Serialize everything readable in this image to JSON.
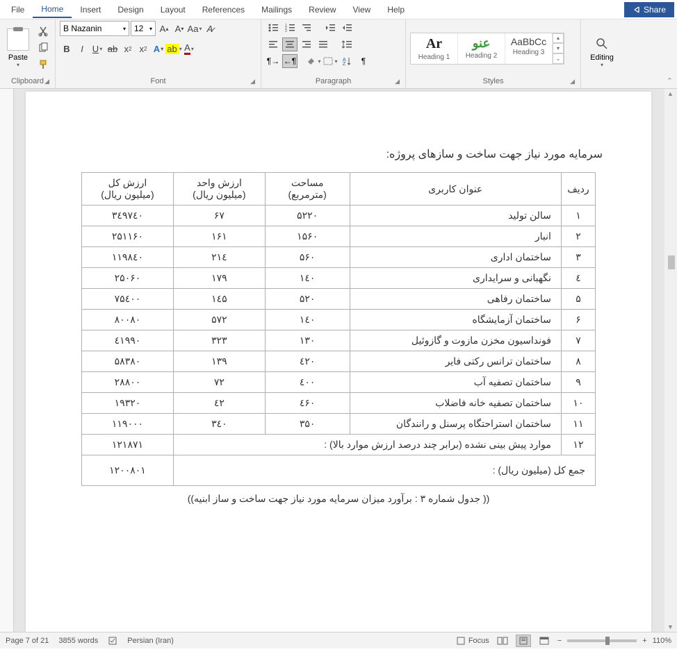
{
  "menu": {
    "items": [
      "File",
      "Home",
      "Insert",
      "Design",
      "Layout",
      "References",
      "Mailings",
      "Review",
      "View",
      "Help"
    ],
    "active": "Home",
    "share": "Share"
  },
  "ribbon": {
    "clipboard": {
      "paste": "Paste",
      "label": "Clipboard"
    },
    "font": {
      "name": "B Nazanin",
      "size": "12",
      "label": "Font"
    },
    "paragraph": {
      "label": "Paragraph"
    },
    "styles": {
      "items": [
        {
          "preview": "Ar",
          "label": "Heading 1",
          "color": "#222",
          "font": "serif",
          "weight": "bold"
        },
        {
          "preview": "ﻋﻨﻮ",
          "label": "Heading 2",
          "color": "#3a9c3a",
          "font": "sans-serif",
          "weight": "bold"
        },
        {
          "preview": "AaBbCc",
          "label": "Heading 3",
          "color": "#444",
          "font": "sans-serif",
          "weight": "normal"
        }
      ],
      "label": "Styles"
    },
    "editing": {
      "label": "Editing"
    }
  },
  "document": {
    "heading": "سرمایه مورد نیاز جهت ساخت و سازهای پروژه:",
    "caption": "(( جدول شماره ۳ : برآورد میزان سرمایه مورد نیاز جهت ساخت و ساز ابنیه))",
    "headers": {
      "row": "ردیف",
      "title": "عنوان کاربری",
      "area1": "مساحت",
      "area2": "(مترمربع)",
      "unit1": "ارزش واحد",
      "unit2": "(میلیون ریال)",
      "total1": "ارزش کل",
      "total2": "(میلیون ریال)"
    },
    "rows": [
      {
        "n": "۱",
        "title": "سالن تولید",
        "area": "۵۲۲۰",
        "unit": "۶۷",
        "total": "۳٤۹۷٤۰"
      },
      {
        "n": "۲",
        "title": "انبار",
        "area": "۱۵۶۰",
        "unit": "۱۶۱",
        "total": "۲۵۱۱۶۰"
      },
      {
        "n": "۳",
        "title": "ساختمان اداری",
        "area": "۵۶۰",
        "unit": "۲۱٤",
        "total": "۱۱۹۸٤۰"
      },
      {
        "n": "٤",
        "title": "نگهبانی و سرایداری",
        "area": "۱٤۰",
        "unit": "۱۷۹",
        "total": "۲۵۰۶۰"
      },
      {
        "n": "۵",
        "title": "ساختمان رفاهی",
        "area": "۵۲۰",
        "unit": "۱٤۵",
        "total": "۷۵٤۰۰"
      },
      {
        "n": "۶",
        "title": "ساختمان آزمایشگاه",
        "area": "۱٤۰",
        "unit": "۵۷۲",
        "total": "۸۰۰۸۰"
      },
      {
        "n": "۷",
        "title": "فونداسیون مخزن مازوت و گازوئیل",
        "area": "۱۳۰",
        "unit": "۳۲۳",
        "total": "٤۱۹۹۰"
      },
      {
        "n": "۸",
        "title": "ساختمان ترانس رکتی فایر",
        "area": "٤۲۰",
        "unit": "۱۳۹",
        "total": "۵۸۳۸۰"
      },
      {
        "n": "۹",
        "title": "ساختمان تصفیه آب",
        "area": "٤۰۰",
        "unit": "۷۲",
        "total": "۲۸۸۰۰"
      },
      {
        "n": "۱۰",
        "title": "ساختمان تصفیه خانه فاضلاب",
        "area": "٤۶۰",
        "unit": "٤۲",
        "total": "۱۹۳۲۰"
      },
      {
        "n": "۱۱",
        "title": "ساختمان استراحتگاه پرسنل و رانندگان",
        "area": "۳۵۰",
        "unit": "۳٤۰",
        "total": "۱۱۹۰۰۰"
      }
    ],
    "row12": {
      "n": "۱۲",
      "title": "موارد پیش بینی نشده (برابر چند درصد ارزش موارد بالا) :",
      "total": "۱۲۱۸۷۱"
    },
    "sum": {
      "label": "جمع کل (میلیون ریال) :",
      "total": "۱۲۰۰۸۰۱"
    }
  },
  "status": {
    "page": "Page 7 of 21",
    "words": "3855 words",
    "lang": "Persian (Iran)",
    "focus": "Focus",
    "zoom": "110%"
  }
}
